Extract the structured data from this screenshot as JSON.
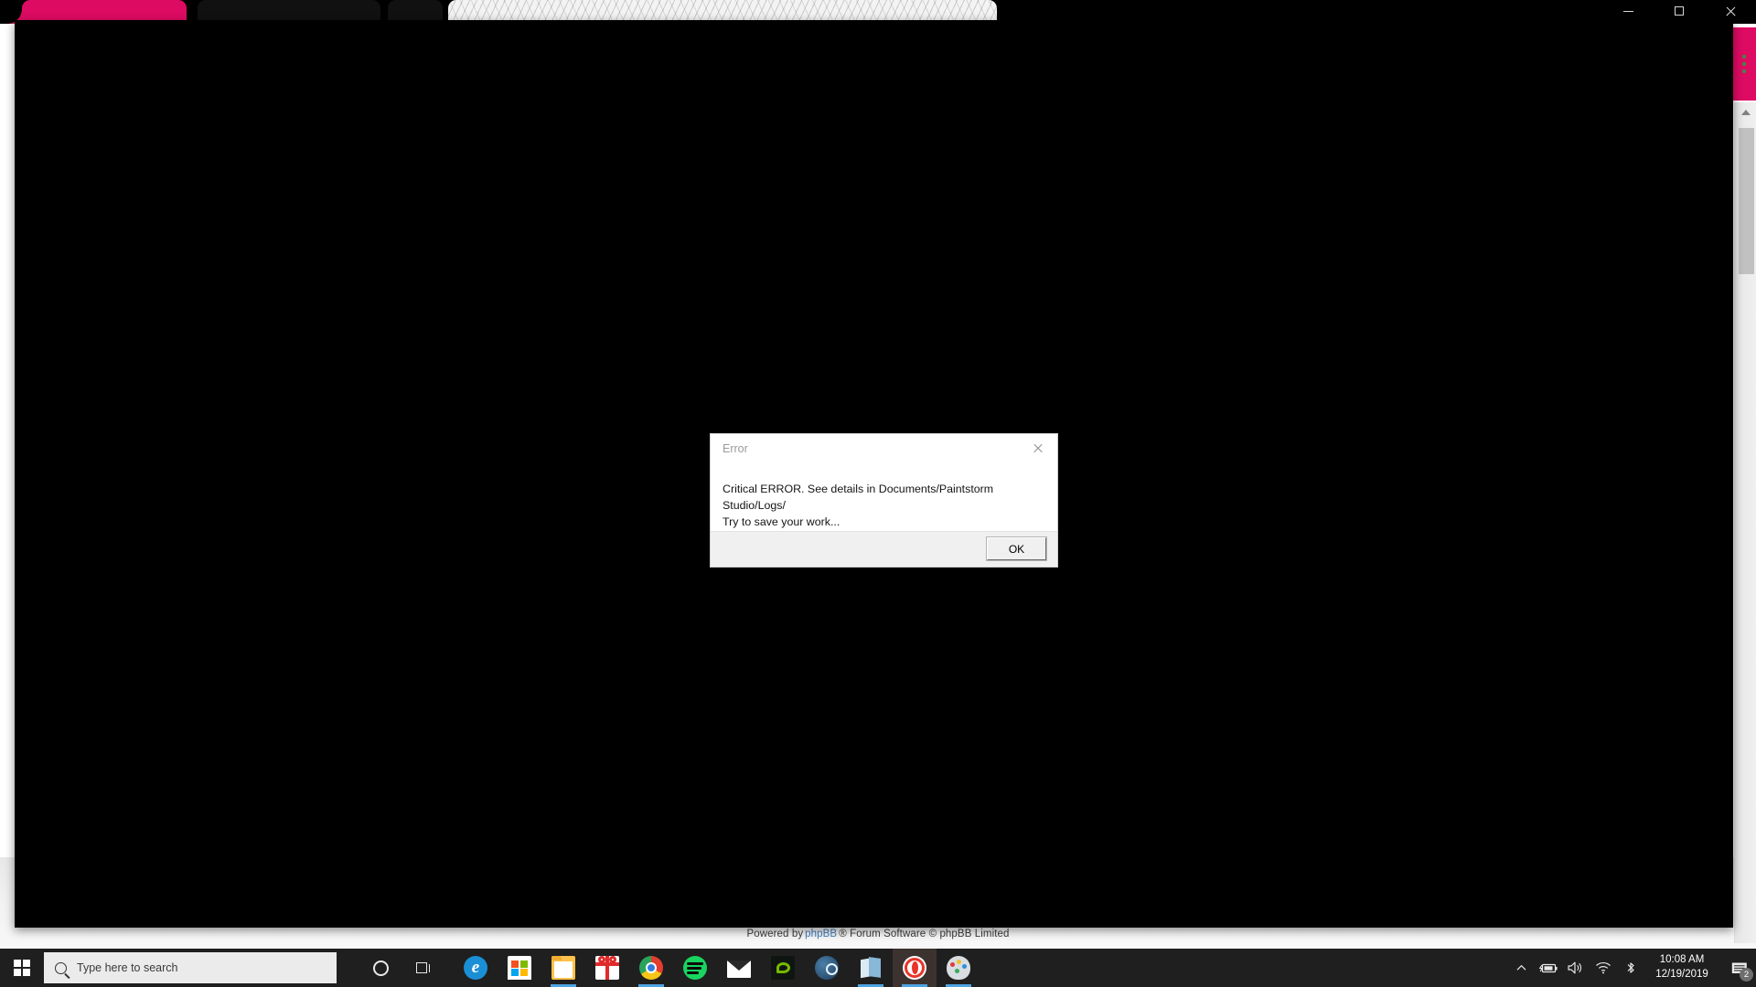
{
  "browser": {
    "tabs": [
      {
        "name": "tab-active-pink",
        "color": "#de0b63",
        "label": ""
      },
      {
        "name": "tab-dark-1",
        "color": "#111112",
        "label": ""
      },
      {
        "name": "tab-dark-2",
        "color": "#111112",
        "label": ""
      },
      {
        "name": "tab-light",
        "color": "#f3f3f3",
        "label": ""
      }
    ],
    "window_controls": {
      "minimize": "",
      "maximize": "",
      "close": ""
    },
    "side_panel_color": "#de0b63",
    "footer": {
      "prefix": "Powered by",
      "brand": "phpBB",
      "suffix": "® Forum Software © phpBB Limited"
    }
  },
  "dialog": {
    "title": "Error",
    "message": "Critical ERROR. See details in Documents/Paintstorm Studio/Logs/\n Try to save your work...",
    "ok_label": "OK",
    "close_label": "Close",
    "background": "#ffffff",
    "footer_background": "#f0f0f0"
  },
  "taskbar": {
    "background": "#1f1f1f",
    "start_label": "Start",
    "search": {
      "placeholder": "Type here to search",
      "value": ""
    },
    "cortana_label": "Cortana",
    "taskview_label": "Task View",
    "apps": [
      {
        "name": "microsoft-edge",
        "label": "Microsoft Edge",
        "running": false,
        "active": false
      },
      {
        "name": "microsoft-store",
        "label": "Microsoft Store",
        "running": false,
        "active": false
      },
      {
        "name": "file-explorer",
        "label": "File Explorer",
        "running": true,
        "active": false
      },
      {
        "name": "gift-app",
        "label": "Gift",
        "running": false,
        "active": false
      },
      {
        "name": "google-chrome",
        "label": "Google Chrome",
        "running": true,
        "active": false
      },
      {
        "name": "spotify",
        "label": "Spotify",
        "running": false,
        "active": false
      },
      {
        "name": "mail",
        "label": "Mail",
        "running": false,
        "active": false
      },
      {
        "name": "nvidia",
        "label": "NVIDIA",
        "running": false,
        "active": false
      },
      {
        "name": "steam",
        "label": "Steam",
        "running": false,
        "active": false
      },
      {
        "name": "sticky-notes",
        "label": "Sticky Notes",
        "running": true,
        "active": false
      },
      {
        "name": "opera",
        "label": "Opera",
        "running": true,
        "active": true
      },
      {
        "name": "paint",
        "label": "Paint",
        "running": true,
        "active": false
      }
    ],
    "tray": {
      "chevron_label": "Show hidden icons",
      "battery_label": "Battery charging",
      "volume_label": "Volume",
      "network_label": "Network",
      "bluetooth_label": "Bluetooth",
      "time": "10:08 AM",
      "date": "12/19/2019",
      "notification_count": "2"
    }
  }
}
